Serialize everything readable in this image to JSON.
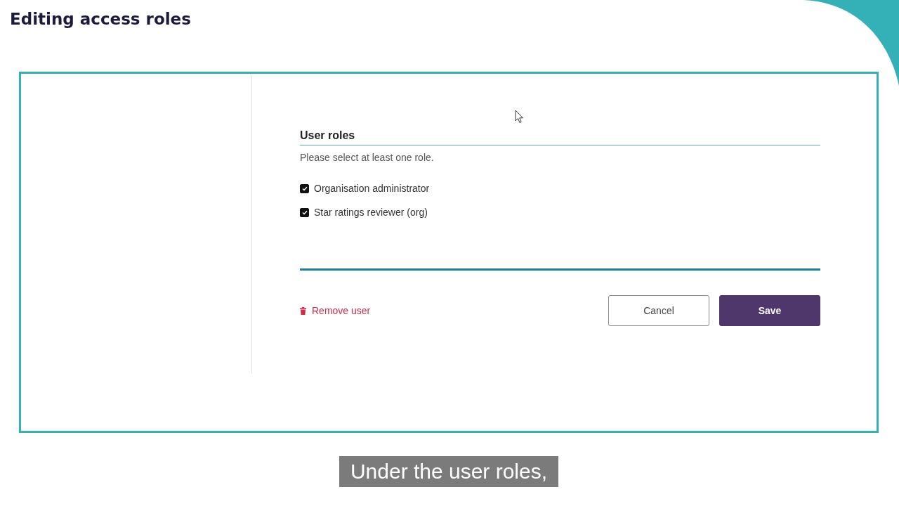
{
  "header": {
    "title": "Editing access roles"
  },
  "form": {
    "section_title": "User roles",
    "hint": "Please select at least one role.",
    "roles": [
      {
        "label": "Organisation administrator",
        "checked": true
      },
      {
        "label": "Star ratings reviewer (org)",
        "checked": true
      }
    ],
    "remove_link": "Remove user",
    "buttons": [
      {
        "label": "Cancel",
        "kind": "secondary"
      },
      {
        "label": "Save",
        "kind": "primary"
      }
    ]
  },
  "caption": "Under the user roles,"
}
